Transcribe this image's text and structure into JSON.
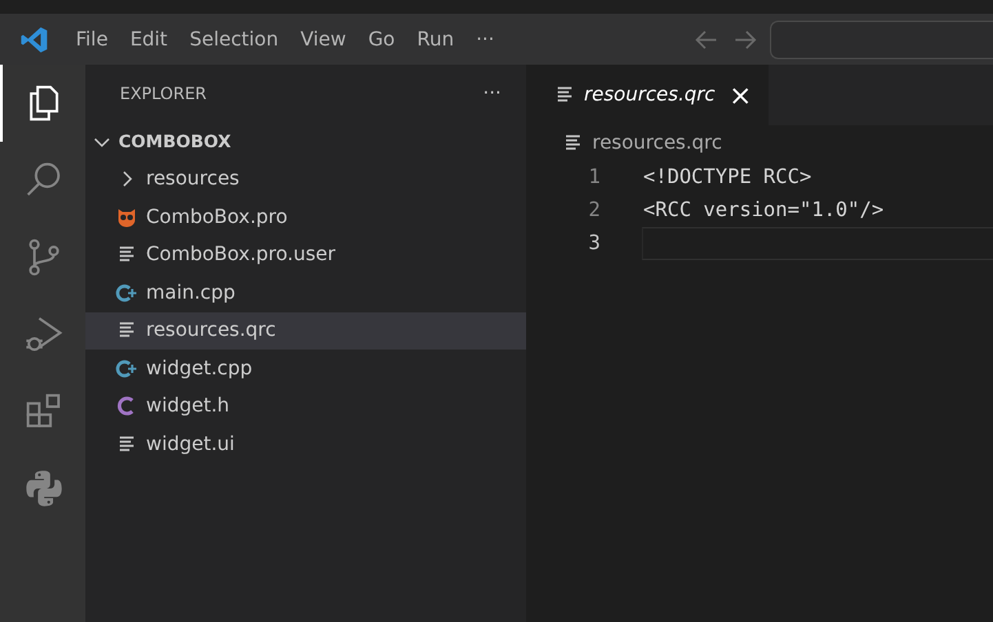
{
  "menu_bar": {
    "items": [
      "File",
      "Edit",
      "Selection",
      "View",
      "Go",
      "Run",
      "···"
    ]
  },
  "activity_bar": [
    {
      "kind": "explorer",
      "selected": true
    },
    {
      "kind": "search",
      "selected": false
    },
    {
      "kind": "source-control",
      "selected": false
    },
    {
      "kind": "run-debug",
      "selected": false
    },
    {
      "kind": "extensions",
      "selected": false
    },
    {
      "kind": "python",
      "selected": false
    }
  ],
  "sidebar": {
    "title": "EXPLORER",
    "more": "···",
    "folder": {
      "label": "COMBOBOX",
      "expanded": true,
      "children": [
        {
          "label": "resources",
          "kind": "folder",
          "expanded": false,
          "selected": false
        },
        {
          "label": "ComboBox.pro",
          "kind": "qt",
          "selected": false
        },
        {
          "label": "ComboBox.pro.user",
          "kind": "text",
          "selected": false
        },
        {
          "label": "main.cpp",
          "kind": "cpp",
          "selected": false
        },
        {
          "label": "resources.qrc",
          "kind": "text",
          "selected": true
        },
        {
          "label": "widget.cpp",
          "kind": "cpp",
          "selected": false
        },
        {
          "label": "widget.h",
          "kind": "c",
          "selected": false
        },
        {
          "label": "widget.ui",
          "kind": "text",
          "selected": false
        }
      ]
    }
  },
  "editor": {
    "tabs": [
      {
        "label": "resources.qrc",
        "selected": true,
        "close": "×"
      }
    ],
    "breadcrumb": "resources.qrc",
    "lines": [
      {
        "number": "1",
        "text": "<!DOCTYPE RCC>",
        "current": false
      },
      {
        "number": "2",
        "text": "<RCC version=\"1.0\"/>",
        "current": false
      },
      {
        "number": "3",
        "current": true
      }
    ]
  }
}
